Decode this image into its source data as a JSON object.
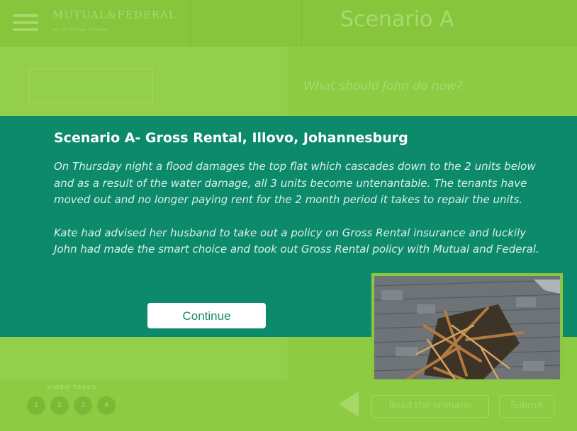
{
  "app": {
    "logo_text": "MUTUAL&FEDERAL",
    "logo_tagline": "AN OLD MUTUAL COMPANY",
    "menu_icon": "hamburger-icon"
  },
  "header": {
    "title": "Scenario A"
  },
  "background": {
    "question": "What should John do now?"
  },
  "modal": {
    "title": "Scenario A- Gross Rental, Illovo, Johannesburg",
    "paragraphs": [
      "On Thursday night a flood damages the top flat which cascades down to the 2 units below and as a result of the water damage, all 3 units become untenantable. The tenants have moved out and no longer paying rent for the 2 month period it takes to repair the units.",
      "Kate had advised her husband to take out a policy on Gross Rental insurance and luckily John had made the smart choice and took out Gross Rental policy with Mutual and Federal."
    ],
    "continue_label": "Continue",
    "image_description_icon": "damaged-roof-photo"
  },
  "footer": {
    "video_label": "VIDEO TASKS",
    "steps": [
      "1",
      "2",
      "3",
      "4"
    ],
    "read_label": "Read the scenario",
    "submit_label": "Submit"
  },
  "colors": {
    "overlay": "#0d8a6c",
    "background_green": "#8ccb42",
    "button_text": "#1a8a6c"
  }
}
